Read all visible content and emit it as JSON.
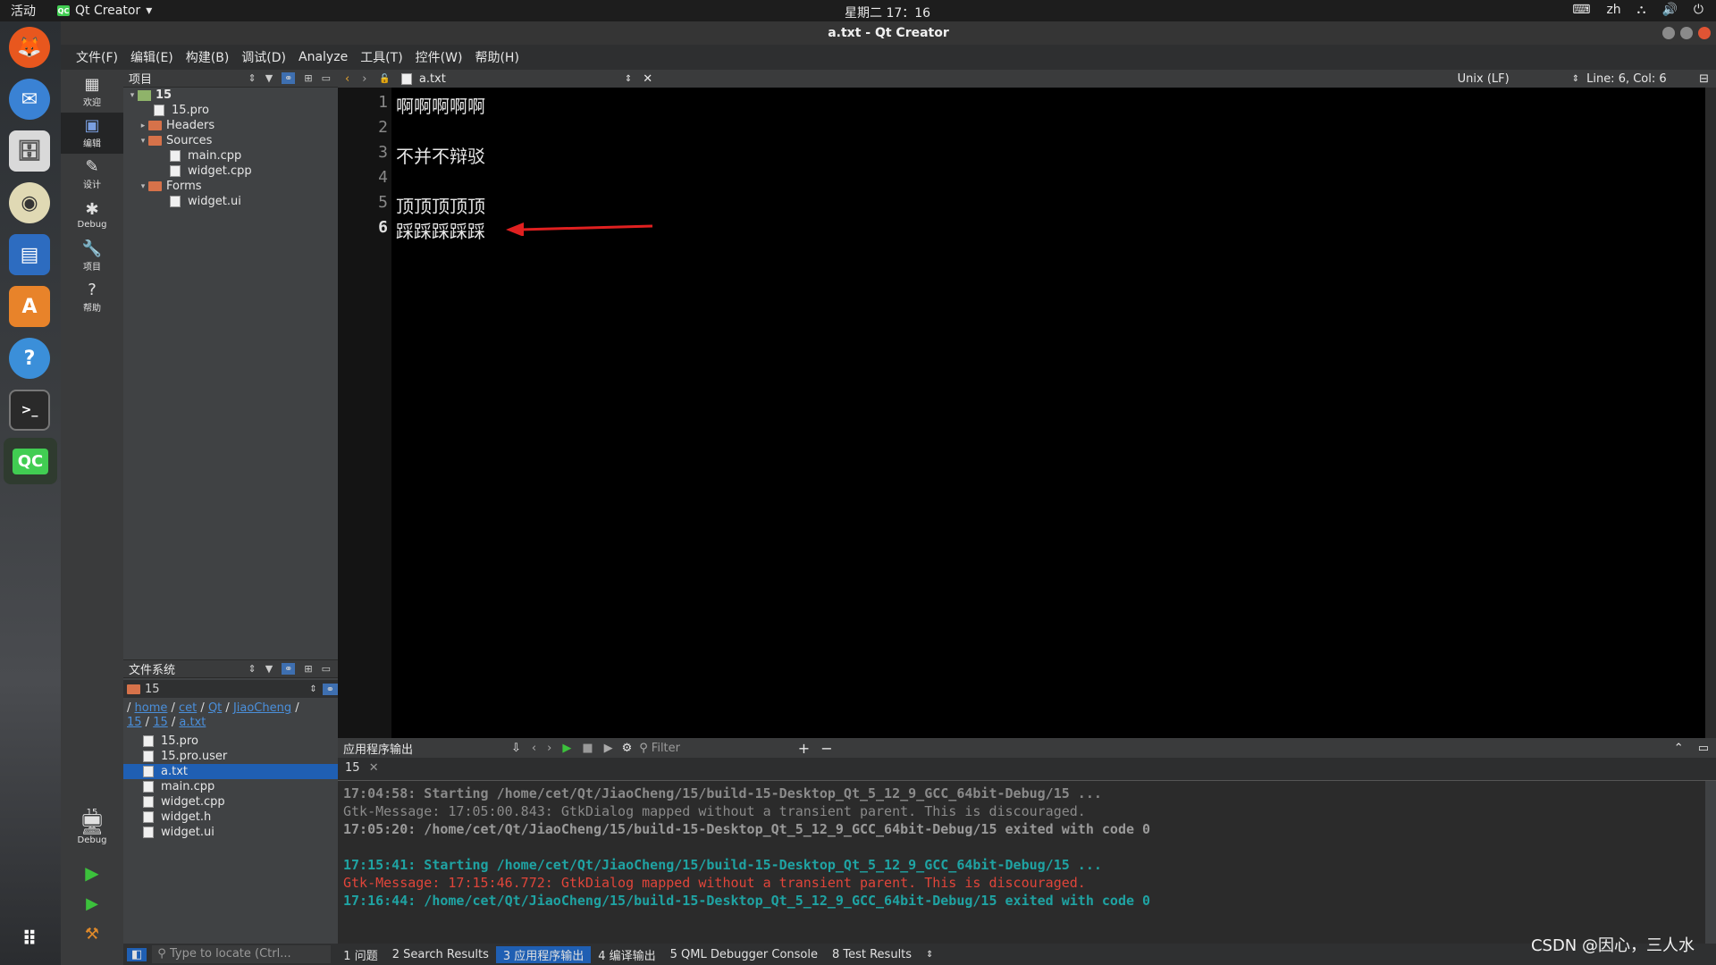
{
  "topbar": {
    "activities": "活动",
    "app_name": "Qt Creator",
    "clock": "星期二 17：16",
    "lang": "zh"
  },
  "window": {
    "title": "a.txt - Qt Creator"
  },
  "menu": [
    "文件(F)",
    "编辑(E)",
    "构建(B)",
    "调试(D)",
    "Analyze",
    "工具(T)",
    "控件(W)",
    "帮助(H)"
  ],
  "modes": [
    {
      "label": "欢迎",
      "icon": "grid-icon"
    },
    {
      "label": "编辑",
      "icon": "edit-icon"
    },
    {
      "label": "设计",
      "icon": "pencil-icon"
    },
    {
      "label": "Debug",
      "icon": "bug-icon"
    },
    {
      "label": "项目",
      "icon": "wrench-icon"
    },
    {
      "label": "帮助",
      "icon": "help-icon"
    }
  ],
  "kit": {
    "project": "15",
    "mode": "Debug"
  },
  "projects_pane": {
    "title": "项目",
    "root": "15",
    "items": [
      "15.pro",
      "Headers",
      "Sources",
      "main.cpp",
      "widget.cpp",
      "Forms",
      "widget.ui"
    ]
  },
  "fs_pane": {
    "title": "文件系统",
    "folder": "15",
    "crumbs": [
      "home",
      "cet",
      "Qt",
      "JiaoCheng",
      "15",
      "15",
      "a.txt"
    ],
    "files": [
      "15.pro",
      "15.pro.user",
      "a.txt",
      "main.cpp",
      "widget.cpp",
      "widget.h",
      "widget.ui"
    ]
  },
  "editor": {
    "file": "a.txt",
    "line_ending": "Unix (LF)",
    "cursor": "Line: 6, Col: 6",
    "lines": [
      "啊啊啊啊啊",
      "",
      "不并不辩驳",
      "",
      "顶顶顶顶顶",
      "踩踩踩踩踩"
    ]
  },
  "output": {
    "title": "应用程序输出",
    "filter_placeholder": "Filter",
    "tab": "15",
    "lines": [
      {
        "text": "17:04:58: Starting /home/cet/Qt/JiaoCheng/15/build-15-Desktop_Qt_5_12_9_GCC_64bit-Debug/15 ...",
        "color": "#8a8a8a"
      },
      {
        "text": "Gtk-Message: 17:05:00.843: GtkDialog mapped without a transient parent. This is discouraged.",
        "color": "#8a8a8a"
      },
      {
        "text": "17:05:20: /home/cet/Qt/JiaoCheng/15/build-15-Desktop_Qt_5_12_9_GCC_64bit-Debug/15 exited with code 0",
        "color": "#9a9a9a"
      },
      {
        "text": "",
        "color": "#8a8a8a"
      },
      {
        "text": "17:15:41: Starting /home/cet/Qt/JiaoCheng/15/build-15-Desktop_Qt_5_12_9_GCC_64bit-Debug/15 ...",
        "color": "#1fa3a3"
      },
      {
        "text": "Gtk-Message: 17:15:46.772: GtkDialog mapped without a transient parent. This is discouraged.",
        "color": "#e0453a"
      },
      {
        "text": "17:16:44: /home/cet/Qt/JiaoCheng/15/build-15-Desktop_Qt_5_12_9_GCC_64bit-Debug/15 exited with code 0",
        "color": "#1fa3a3"
      }
    ]
  },
  "statusbar": {
    "locate_placeholder": "Type to locate (Ctrl...",
    "tabs": [
      "1 问题",
      "2 Search Results",
      "3 应用程序输出",
      "4 编译输出",
      "5 QML Debugger Console",
      "8 Test Results"
    ]
  },
  "watermark": "CSDN @因心，三人水",
  "colors": {
    "accent": "#1f5fb3",
    "arrow": "#e02020"
  }
}
